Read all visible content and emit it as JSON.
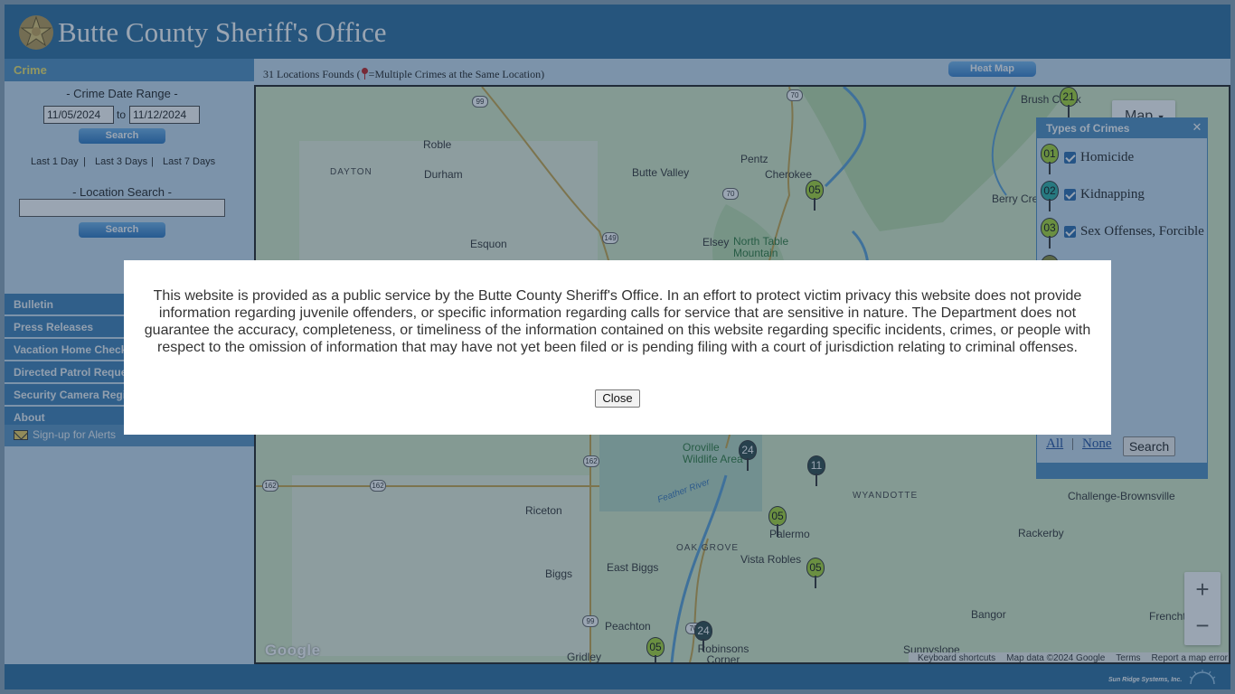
{
  "header": {
    "title": "Butte County Sheriff's Office"
  },
  "sidebar": {
    "section_title": "Crime",
    "date_range_label": "- Crime Date Range -",
    "start_date": "11/05/2024",
    "to_label": "to",
    "end_date": "11/12/2024",
    "search_label": "Search",
    "quick_links": [
      "Last 1 Day",
      "Last 3 Days",
      "Last 7 Days"
    ],
    "separator": "|",
    "location_label": "- Location Search -",
    "location_value": "",
    "location_search_label": "Search",
    "nav": [
      "Bulletin",
      "Press Releases",
      "Vacation Home Check",
      "Directed Patrol Request",
      "Security Camera Registration",
      "About"
    ],
    "signup_label": "Sign-up for Alerts"
  },
  "topbar": {
    "locations_text": "31 Locations Founds (",
    "multiple_text": "=Multiple Crimes at the Same Location)",
    "heatmap_label": "Heat Map"
  },
  "map": {
    "type_button": "Map",
    "zoom_in": "+",
    "zoom_out": "−",
    "google_logo": "Google",
    "attribution": [
      "Keyboard shortcuts",
      "Map data ©2024 Google",
      "Terms",
      "Report a map error"
    ],
    "places": [
      "Roble",
      "DAYTON",
      "Durham",
      "Butte Valley",
      "Pentz",
      "Cherokee",
      "Berry Creek",
      "Brush Creek",
      "Esquon",
      "Elsey",
      "North Table Mountain",
      "Oroville Wildlife Area",
      "Feather River",
      "Riceton",
      "Palermo",
      "OAK GROVE",
      "WYANDOTTE",
      "Challenge-Brownsville",
      "Rackerby",
      "Biggs",
      "East Biggs",
      "Vista Robles",
      "Bangor",
      "Frenchtown",
      "Peachton",
      "Robinsons Corner",
      "Gridley",
      "Sunnyslope"
    ],
    "highways": [
      "99",
      "70",
      "70",
      "149",
      "162",
      "162",
      "162",
      "99",
      "70"
    ],
    "markers": [
      "05",
      "24",
      "11",
      "05",
      "05",
      "24",
      "05",
      "21"
    ]
  },
  "crime_panel": {
    "title": "Types of Crimes",
    "close": "✕",
    "types": [
      {
        "code": "01",
        "label": "Homicide"
      },
      {
        "code": "02",
        "label": "Kidnapping"
      },
      {
        "code": "03",
        "label": "Sex Offenses, Forcible"
      }
    ],
    "all_label": "All",
    "sep": "|",
    "none_label": "None",
    "search_label": "Search"
  },
  "footer": {
    "brand": "Sun Ridge Systems, Inc."
  },
  "modal": {
    "text": "This website is provided as a public service by the Butte County Sheriff's Office. In an effort to protect victim privacy this website does not provide information regarding juvenile offenders, or specific information regarding calls for service that are sensitive in nature. The Department does not guarantee the accuracy, completeness, or timeliness of the information contained on this website regarding specific incidents, crimes, or people with respect to the omission of information that may have not yet been filed or is pending filing with a court of jurisdiction relating to criminal offenses.",
    "close_label": "Close"
  },
  "colors": {
    "header_blue": "#2d6d9e",
    "sidebar_bg": "#c9dff0",
    "nav_blue": "#3f80b6",
    "crime_title": "#f2e56b",
    "overlay": "#1e3755",
    "marker_lime": "#a8d832",
    "marker_teal": "#2fb0a4",
    "marker_dark": "#2e4a48"
  }
}
